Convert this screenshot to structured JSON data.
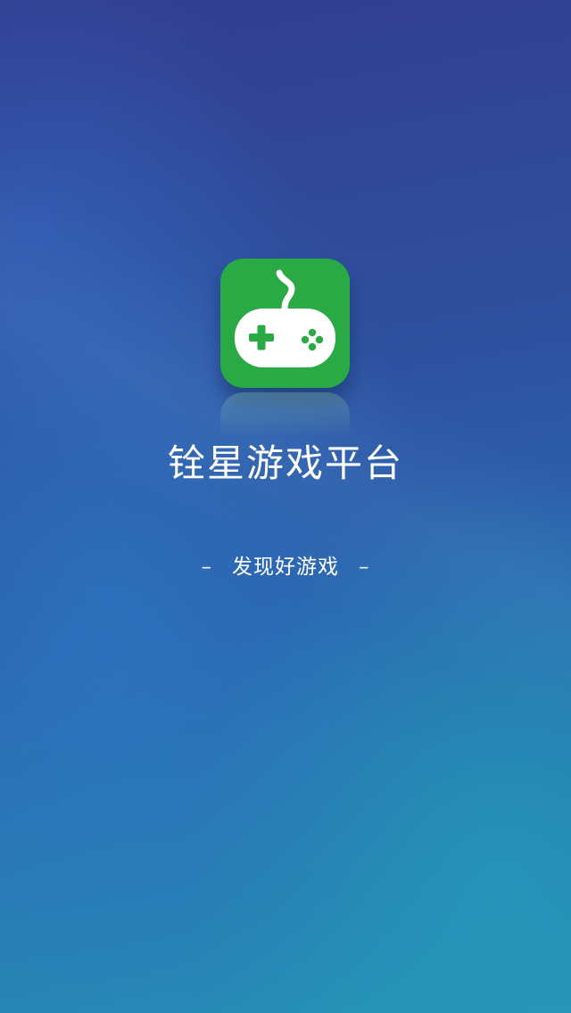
{
  "app": {
    "title": "铨星游戏平台",
    "tagline": "发现好游戏",
    "tagline_left_dash": "–",
    "tagline_right_dash": "–"
  },
  "logo": {
    "icon": "gamepad-icon",
    "background_color": "#2aaa44"
  },
  "colors": {
    "background_top": "#323c8e",
    "background_bottom": "#2694b5",
    "text": "#ffffff"
  }
}
